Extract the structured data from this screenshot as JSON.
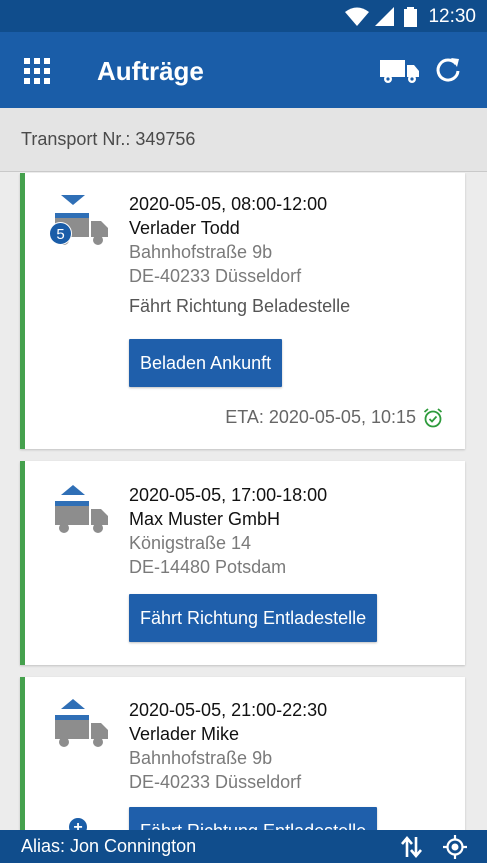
{
  "status_bar": {
    "time": "12:30"
  },
  "app_bar": {
    "title": "Aufträge"
  },
  "transport": {
    "label": "Transport Nr.: 349756"
  },
  "orders": [
    {
      "time": "2020-05-05, 08:00-12:00",
      "name": "Verlader Todd",
      "street": "Bahnhofstraße 9b",
      "city": "DE-40233 Düsseldorf",
      "state": "Fährt Richtung Beladestelle",
      "badge": "5",
      "button": "Beladen Ankunft",
      "eta": "ETA: 2020-05-05, 10:15"
    },
    {
      "time": "2020-05-05, 17:00-18:00",
      "name": "Max Muster GmbH",
      "street": "Königstraße 14",
      "city": "DE-14480 Potsdam",
      "button": "Fährt Richtung Entladestelle"
    },
    {
      "time": "2020-05-05, 21:00-22:30",
      "name": "Verlader Mike",
      "street": "Bahnhofstraße 9b",
      "city": "DE-40233 Düsseldorf",
      "button": "Fährt Richtung Entladestelle"
    }
  ],
  "bottom_bar": {
    "alias": "Alias:  Jon Connington"
  },
  "icons": {
    "grid": "apps-grid-icon",
    "truck": "truck-icon",
    "refresh": "refresh-icon",
    "sort": "sort-arrows-icon",
    "locate": "gps-locate-icon",
    "eta": "alarm-check-icon"
  },
  "colors": {
    "primary": "#1a5da8",
    "dark": "#104d8c",
    "accent_green": "#45a14d",
    "button": "#1f5fab"
  }
}
